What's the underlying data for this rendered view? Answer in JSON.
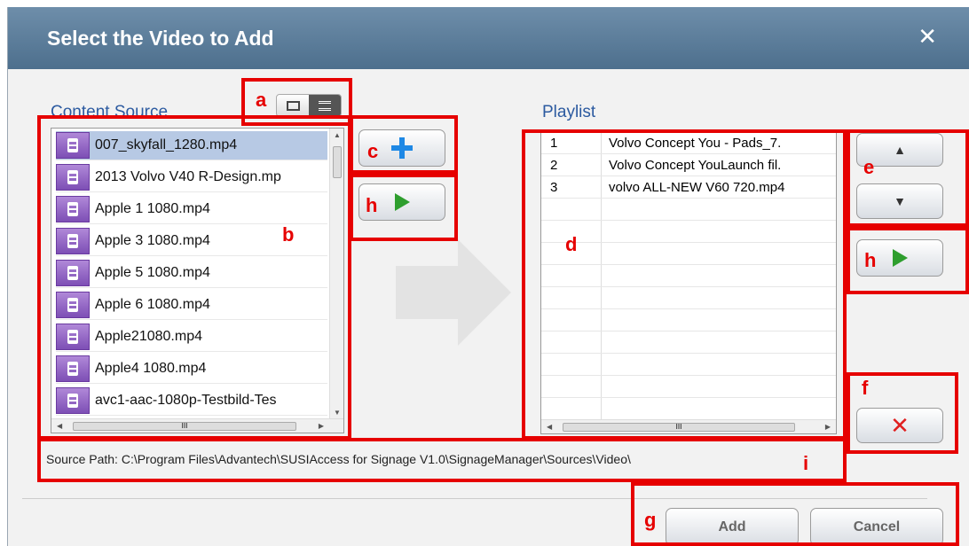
{
  "dialog": {
    "title": "Select the Video to Add",
    "close_glyph": "✕"
  },
  "content_source": {
    "label": "Content Source",
    "files": [
      "007_skyfall_1280.mp4",
      "2013 Volvo V40 R-Design.mp",
      "Apple 1 1080.mp4",
      "Apple 3 1080.mp4",
      "Apple 5 1080.mp4",
      "Apple 6 1080.mp4",
      "Apple21080.mp4",
      "Apple4 1080.mp4",
      "avc1-aac-1080p-Testbild-Tes"
    ],
    "selected_index": 0,
    "file_icon": "video-file-icon"
  },
  "view_toggle": {
    "icons": [
      "single-view-icon",
      "list-view-icon"
    ],
    "active": "list-view-icon"
  },
  "playlist": {
    "label": "Playlist",
    "rows": [
      {
        "num": "1",
        "name": "Volvo Concept You - Pads_7."
      },
      {
        "num": "2",
        "name": "Volvo Concept YouLaunch fil."
      },
      {
        "num": "3",
        "name": "volvo ALL-NEW V60 720.mp4"
      }
    ]
  },
  "buttons": {
    "add_to_playlist_icon": "plus-icon",
    "play_icon": "play-icon",
    "move_up_glyph": "▲",
    "move_down_glyph": "▼",
    "remove_glyph": "✕",
    "add_label": "Add",
    "cancel_label": "Cancel"
  },
  "source_path": "Source Path: C:\\Program Files\\Advantech\\SUSIAccess for Signage V1.0\\SignageManager\\Sources\\Video\\",
  "scroll_glyph": "III",
  "annotations": [
    "a",
    "b",
    "c",
    "h",
    "d",
    "e",
    "h",
    "f",
    "g",
    "i"
  ],
  "colors": {
    "annotation": "#e60000",
    "titlebar": "#5a7a98",
    "label": "#2c5aa0",
    "plus": "#1e88e5",
    "play": "#2e9e2e",
    "remove": "#e02020"
  }
}
